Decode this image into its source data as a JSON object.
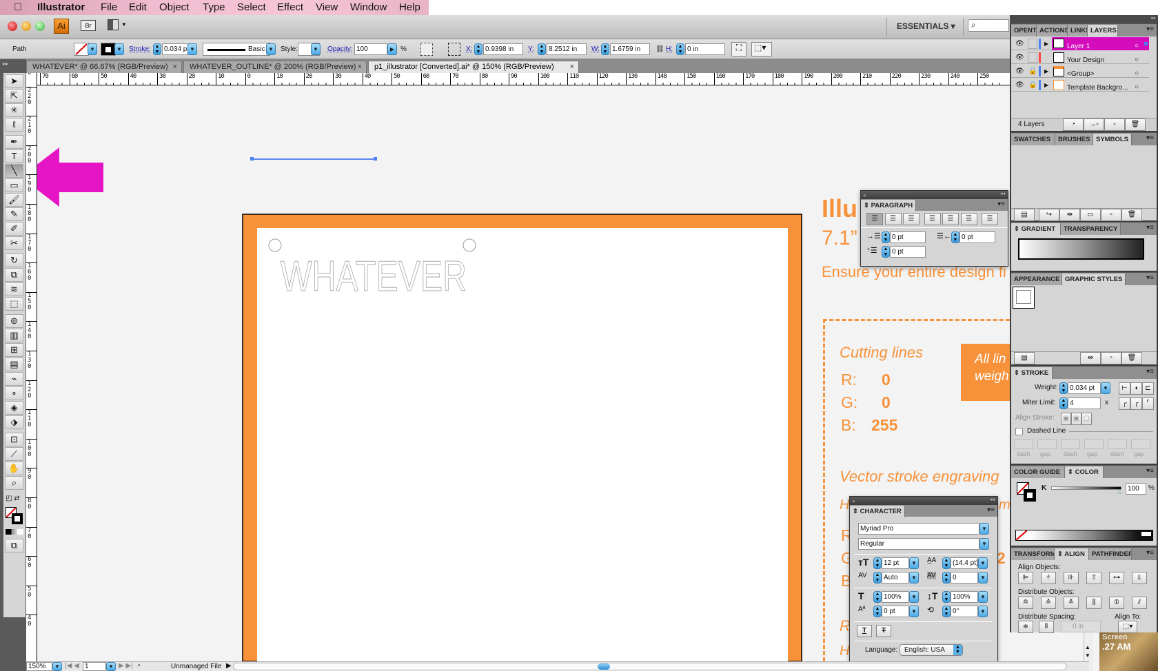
{
  "menu": {
    "app": "Illustrator",
    "items": [
      "File",
      "Edit",
      "Object",
      "Type",
      "Select",
      "Effect",
      "View",
      "Window",
      "Help"
    ]
  },
  "appbar": {
    "ai_badge": "Ai",
    "bridge": "Br",
    "workspace": "ESSENTIALS ▾"
  },
  "control": {
    "selection": "Path",
    "stroke_label": "Stroke:",
    "stroke_value": "0.034 p",
    "brush": "Basic",
    "style_label": "Style:",
    "opacity_label": "Opacity:",
    "opacity_value": "100",
    "opacity_unit": "%",
    "x_label": "X:",
    "x_value": "0.9398 in",
    "y_label": "Y:",
    "y_value": "8.2512 in",
    "w_label": "W:",
    "w_value": "1.6759 in",
    "h_label": "H:",
    "h_value": "0 in"
  },
  "doc_tabs": [
    {
      "label": "WHATEVER* @ 66.67% (RGB/Preview)",
      "active": false
    },
    {
      "label": "WHATEVER_OUTLINE* @ 200% (RGB/Preview)",
      "active": false
    },
    {
      "label": "p1_illustrator [Converted].ai* @ 150% (RGB/Preview)",
      "active": true
    }
  ],
  "rulers": {
    "horizontal": [
      "70",
      "60",
      "50",
      "40",
      "30",
      "20",
      "10",
      "0",
      "10",
      "20",
      "30",
      "40",
      "50",
      "60",
      "70",
      "80",
      "90",
      "100",
      "110",
      "120",
      "130",
      "140",
      "150",
      "160",
      "170",
      "180",
      "190",
      "200",
      "210",
      "220",
      "230",
      "240",
      "250"
    ],
    "vertical": [
      "230",
      "220",
      "210",
      "200",
      "190",
      "180",
      "170",
      "160",
      "150",
      "140",
      "130",
      "120",
      "110",
      "100",
      "90",
      "80",
      "70",
      "60",
      "50",
      "40"
    ]
  },
  "tools": [
    "selection",
    "direct-selection",
    "magic-wand",
    "lasso",
    "pen",
    "type",
    "line-segment",
    "rectangle",
    "paintbrush",
    "pencil",
    "blob-brush",
    "scissors",
    "rotate",
    "scale",
    "warp",
    "free-transform",
    "symbol-sprayer",
    "column-graph",
    "mesh",
    "gradient",
    "eyedropper",
    "blend",
    "live-paint-bucket",
    "live-paint-selection",
    "artboard",
    "slice",
    "hand",
    "zoom"
  ],
  "artwork": {
    "outlined_text": "WHATEVER",
    "title": "Illu",
    "size": "7.1”",
    "instruction": "Ensure your entire design fi",
    "cutting_heading": "Cutting lines",
    "cutting": [
      {
        "k": "R:",
        "v": "0"
      },
      {
        "k": "G:",
        "v": "0"
      },
      {
        "k": "B:",
        "v": "255"
      }
    ],
    "note_lines": [
      "All lin",
      "weigh"
    ],
    "engraving_heading": "Vector stroke engraving",
    "h_partial": "H",
    "m_partial": "m",
    "engraving": [
      {
        "k": "R",
        "v": ""
      },
      {
        "k": "G",
        "v": "2"
      },
      {
        "k": "B",
        "v": ""
      }
    ],
    "r_partial": "R",
    "h_partial2": "H",
    "brand_orange": "#f7923a",
    "arrow_color": "#e514c4"
  },
  "paragraph": {
    "title": "PARAGRAPH",
    "left_indent": "0 pt",
    "right_indent": "0 pt",
    "first_line": "0 pt"
  },
  "character": {
    "title": "CHARACTER",
    "font": "Myriad Pro",
    "style": "Regular",
    "size": "12 pt",
    "leading": "(14.4 pt)",
    "kerning": "Auto",
    "tracking": "0",
    "hscale": "100%",
    "vscale": "100%",
    "baseline": "0 pt",
    "rotation": "0°",
    "language_label": "Language:",
    "language": "English: USA"
  },
  "layers": {
    "tabs": [
      "OPENTYPE",
      "ACTIONS",
      "LINKS",
      "LAYERS"
    ],
    "rows": [
      "Layer 1",
      "Your Design",
      "<Group>",
      "Template Backgro..."
    ],
    "count": "4 Layers"
  },
  "swatches": {
    "tabs": [
      "SWATCHES",
      "BRUSHES",
      "SYMBOLS"
    ]
  },
  "gradient": {
    "tabs": [
      "GRADIENT",
      "TRANSPARENCY"
    ]
  },
  "appearance": {
    "tabs": [
      "APPEARANCE",
      "GRAPHIC STYLES"
    ]
  },
  "stroke": {
    "title": "STROKE",
    "weight_label": "Weight:",
    "weight": "0.034 pt",
    "miter_label": "Miter Limit:",
    "miter": "4",
    "miter_unit": "x",
    "align_label": "Align Stroke:",
    "dashed_label": "Dashed Line",
    "dash_labels": [
      "dash",
      "gap",
      "dash",
      "gap",
      "dash",
      "gap"
    ]
  },
  "color": {
    "tabs": [
      "COLOR GUIDE",
      "COLOR"
    ],
    "channel": "K",
    "value": "100",
    "unit": "%"
  },
  "align": {
    "tabs": [
      "TRANSFORM",
      "ALIGN",
      "PATHFINDER"
    ],
    "align_objects": "Align Objects:",
    "distribute_objects": "Distribute Objects:",
    "distribute_spacing": "Distribute Spacing:",
    "spacing_value": "0 in",
    "align_to": "Align To:"
  },
  "status": {
    "zoom": "150%",
    "artboard": "1",
    "info": "Unmanaged File"
  },
  "desktop": {
    "label1": "Screen",
    "label2": ".27 AM"
  }
}
